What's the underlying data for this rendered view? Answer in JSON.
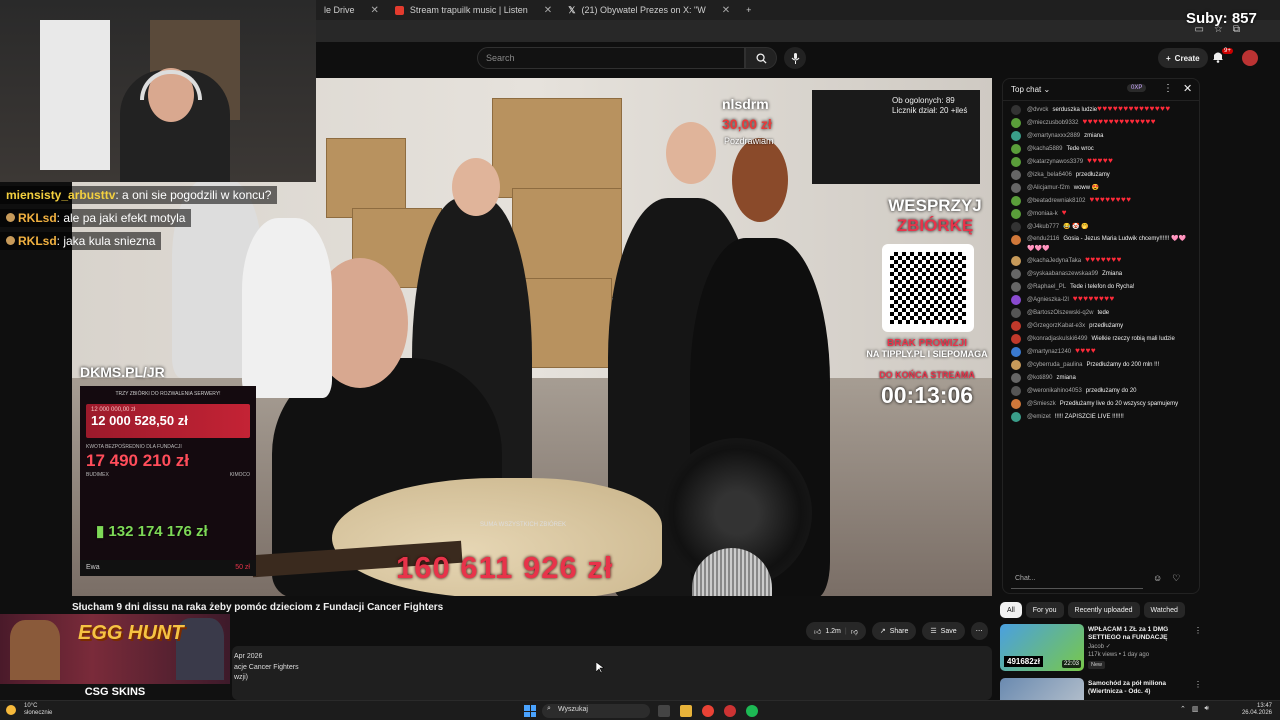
{
  "browser": {
    "tabs": [
      {
        "label": "le Drive",
        "color": "#4285f4"
      },
      {
        "label": "Stream trapuilk music | Listen",
        "color": "#e33b2e"
      },
      {
        "label": "(21) Obywatel Prezes on X: \"W",
        "color": "#ffffff"
      }
    ],
    "new_tab": "+"
  },
  "subscribers": "Suby: 857",
  "header": {
    "search_placeholder": "Search",
    "create_label": "Create",
    "notif_badge": "9+"
  },
  "video": {
    "donor_name": "nlsdrm",
    "donation_amount": "30,00 zł",
    "donation_msg": "Pozdrawiam",
    "cam_text_1": "Ob ogolonych: 89",
    "cam_text_2": "Licznik dział: 20 +ileś",
    "wesprzyj_1": "WESPRZYJ",
    "wesprzyj_2": "ZBIÓRKĘ",
    "brak_1": "BRAK PROWIZJI",
    "brak_2": "NA TIPPLY.PL I SIEPOMAGA",
    "do_konca": "DO KOŃCA STREAMA",
    "timer": "00:13:06",
    "dkms": "DKMS.PL/JR",
    "panel_header": "TRZY ZBIÓRKI DO ROZWALENIA SERWERY!",
    "panel_small": "12 000 000,00 zł",
    "panel_big": "12 000 528,50 zł",
    "panel_sub": "KWOTA BEZPOŚREDNIO DLA FUNDACJI",
    "panel_big2": "17 490 210 zł",
    "panel_sub2_left": "BUDIMEX",
    "panel_sub2_right": "KIMOCO",
    "green_total": "132 174 176 zł",
    "ewa_name": "Ewa",
    "ewa_value": "50 zł",
    "big_total": "160 611 926 zł",
    "big_total_caption": "SUMA WSZYSTKICH ZBIÓREK"
  },
  "overlay_chat": [
    {
      "name": "miensisty_arbusttv",
      "text": ": a oni sie pogodzili w koncu?",
      "style": "y"
    },
    {
      "name": "RKLsd",
      "text": ": ale pa jaki efekt motyla",
      "style": "o"
    },
    {
      "name": "RKLsd",
      "text": ": jaka kula sniezna",
      "style": "o"
    }
  ],
  "title": "Słucham 9 dni dissu na raka żeby pomóc dzieciom z Fundacji Cancer Fighters",
  "actions": {
    "likes": "1.2m",
    "share": "Share",
    "save": "Save"
  },
  "description": {
    "line1": "Apr 2026",
    "line2": "acje Cancer Fighters",
    "line3": "wzji)"
  },
  "ad": {
    "title": "EGG HUNT",
    "brand": "CSG SKINS"
  },
  "chat": {
    "header": "Top chat",
    "xp": "0XP",
    "input_placeholder": "Chat...",
    "messages": [
      {
        "user": "@dvvck",
        "text": "serduszka ludzie",
        "hearts": "♥♥♥♥♥♥♥♥♥♥♥♥♥♥",
        "color": "#333"
      },
      {
        "user": "@mieczusbob9332",
        "text": "",
        "hearts": "♥♥♥♥♥♥♥♥♥♥♥♥♥♥",
        "color": "#5a9e3a"
      },
      {
        "user": "@xmartynaxxx2889",
        "text": "zmiana",
        "hearts": "",
        "color": "#3a9e8a"
      },
      {
        "user": "@kacha5889",
        "text": "Tede wroc",
        "hearts": "",
        "color": "#5a9e3a"
      },
      {
        "user": "@katarzynawos3379",
        "text": "",
        "hearts": "♥♥♥♥♥",
        "color": "#5a9e3a"
      },
      {
        "user": "@izka_bela6406",
        "text": "przedłużamy",
        "hearts": "",
        "color": "#666"
      },
      {
        "user": "@Alicjamur-f2m",
        "text": "woww 😍",
        "hearts": "",
        "color": "#666"
      },
      {
        "user": "@beatadrewniak8102",
        "text": "",
        "hearts": "♥♥♥♥♥♥♥♥",
        "color": "#5a9e3a"
      },
      {
        "user": "@moniaa-k",
        "text": "",
        "hearts": "♥",
        "color": "#5a9e3a"
      },
      {
        "user": "@J4kub777",
        "text": "😂 🤡 🤭",
        "hearts": "",
        "color": "#333"
      },
      {
        "user": "@endu2116",
        "text": "Gosia - Jezus Maria Ludwik chcemy!!!!!! 🩷🩷🩷🩷🩷",
        "hearts": "",
        "color": "#d0783a"
      },
      {
        "user": "@kachaJedynaTaka",
        "text": "",
        "hearts": "♥♥♥♥♥♥♥",
        "color": "#c79a5a"
      },
      {
        "user": "@syskaabanaszewskaa99",
        "text": "Zmiana",
        "hearts": "",
        "color": "#666"
      },
      {
        "user": "@Raphael_PL",
        "text": "Tede i telefon do Rycha!",
        "hearts": "",
        "color": "#666"
      },
      {
        "user": "@Agnieszka-l2l",
        "text": "",
        "hearts": "♥♥♥♥♥♥♥♥",
        "color": "#8a4ad0"
      },
      {
        "user": "@BartoszOlszewski-q2w",
        "text": "tede",
        "hearts": "",
        "color": "#555"
      },
      {
        "user": "@GrzegorzKabat-e3x",
        "text": "przedłużamy",
        "hearts": "",
        "color": "#c0392b"
      },
      {
        "user": "@konradjaskulski6499",
        "text": "Wielkie rzeczy robią mali ludzie",
        "hearts": "",
        "color": "#c0392b"
      },
      {
        "user": "@martynaz1240",
        "text": "",
        "hearts": "♥♥♥♥",
        "color": "#3a7ad0"
      },
      {
        "user": "@cyberruda_paulina",
        "text": "Przedłużamy do 200 mln !!!",
        "hearts": "",
        "color": "#c79a5a"
      },
      {
        "user": "@koti890",
        "text": "zmiana",
        "hearts": "",
        "color": "#666"
      },
      {
        "user": "@weronikahino4053",
        "text": "przedłużamy do 20",
        "hearts": "",
        "color": "#555"
      },
      {
        "user": "@Smieszk",
        "text": "Przedłużamy live do 20 wszyscy spamujemy",
        "hearts": "",
        "color": "#d0783a"
      },
      {
        "user": "@emizet",
        "text": "!!!!! ZAPISZCIE LIVE !!!!!!!",
        "hearts": "",
        "color": "#3a9e8a"
      }
    ]
  },
  "chips": [
    {
      "label": "All",
      "active": true
    },
    {
      "label": "For you",
      "active": false
    },
    {
      "label": "Recently uploaded",
      "active": false
    },
    {
      "label": "Watched",
      "active": false
    }
  ],
  "recs": [
    {
      "title": "WPŁACAM 1 ZŁ za 1 DMG SETTIEGO na FUNDACJĘ",
      "channel": "Jacob",
      "views": "117k views • 1 day ago",
      "new": "New",
      "badge": "491682zł",
      "duration": "22:03"
    },
    {
      "title": "Samochód za pół miliona (Wiertnicza - Odc. 4)",
      "channel": "",
      "views": "",
      "new": "",
      "badge": "",
      "duration": ""
    }
  ],
  "taskbar": {
    "temp": "10°C",
    "weather": "słonecznie",
    "search": "Wyszukaj",
    "time": "13:47",
    "date": "26.04.2026"
  }
}
